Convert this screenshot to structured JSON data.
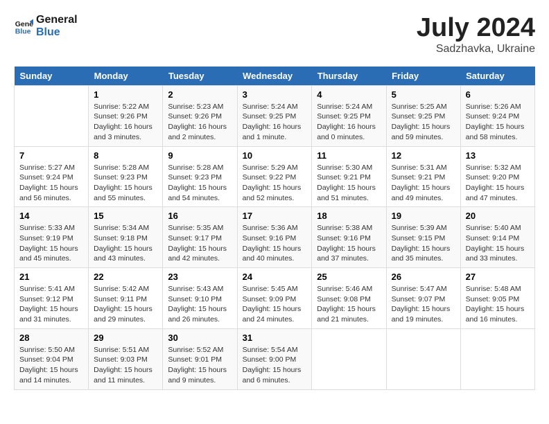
{
  "header": {
    "logo_line1": "General",
    "logo_line2": "Blue",
    "month": "July 2024",
    "location": "Sadzhavka, Ukraine"
  },
  "days_of_week": [
    "Sunday",
    "Monday",
    "Tuesday",
    "Wednesday",
    "Thursday",
    "Friday",
    "Saturday"
  ],
  "weeks": [
    [
      {
        "day": "",
        "info": ""
      },
      {
        "day": "1",
        "info": "Sunrise: 5:22 AM\nSunset: 9:26 PM\nDaylight: 16 hours\nand 3 minutes."
      },
      {
        "day": "2",
        "info": "Sunrise: 5:23 AM\nSunset: 9:26 PM\nDaylight: 16 hours\nand 2 minutes."
      },
      {
        "day": "3",
        "info": "Sunrise: 5:24 AM\nSunset: 9:25 PM\nDaylight: 16 hours\nand 1 minute."
      },
      {
        "day": "4",
        "info": "Sunrise: 5:24 AM\nSunset: 9:25 PM\nDaylight: 16 hours\nand 0 minutes."
      },
      {
        "day": "5",
        "info": "Sunrise: 5:25 AM\nSunset: 9:25 PM\nDaylight: 15 hours\nand 59 minutes."
      },
      {
        "day": "6",
        "info": "Sunrise: 5:26 AM\nSunset: 9:24 PM\nDaylight: 15 hours\nand 58 minutes."
      }
    ],
    [
      {
        "day": "7",
        "info": "Sunrise: 5:27 AM\nSunset: 9:24 PM\nDaylight: 15 hours\nand 56 minutes."
      },
      {
        "day": "8",
        "info": "Sunrise: 5:28 AM\nSunset: 9:23 PM\nDaylight: 15 hours\nand 55 minutes."
      },
      {
        "day": "9",
        "info": "Sunrise: 5:28 AM\nSunset: 9:23 PM\nDaylight: 15 hours\nand 54 minutes."
      },
      {
        "day": "10",
        "info": "Sunrise: 5:29 AM\nSunset: 9:22 PM\nDaylight: 15 hours\nand 52 minutes."
      },
      {
        "day": "11",
        "info": "Sunrise: 5:30 AM\nSunset: 9:21 PM\nDaylight: 15 hours\nand 51 minutes."
      },
      {
        "day": "12",
        "info": "Sunrise: 5:31 AM\nSunset: 9:21 PM\nDaylight: 15 hours\nand 49 minutes."
      },
      {
        "day": "13",
        "info": "Sunrise: 5:32 AM\nSunset: 9:20 PM\nDaylight: 15 hours\nand 47 minutes."
      }
    ],
    [
      {
        "day": "14",
        "info": "Sunrise: 5:33 AM\nSunset: 9:19 PM\nDaylight: 15 hours\nand 45 minutes."
      },
      {
        "day": "15",
        "info": "Sunrise: 5:34 AM\nSunset: 9:18 PM\nDaylight: 15 hours\nand 43 minutes."
      },
      {
        "day": "16",
        "info": "Sunrise: 5:35 AM\nSunset: 9:17 PM\nDaylight: 15 hours\nand 42 minutes."
      },
      {
        "day": "17",
        "info": "Sunrise: 5:36 AM\nSunset: 9:16 PM\nDaylight: 15 hours\nand 40 minutes."
      },
      {
        "day": "18",
        "info": "Sunrise: 5:38 AM\nSunset: 9:16 PM\nDaylight: 15 hours\nand 37 minutes."
      },
      {
        "day": "19",
        "info": "Sunrise: 5:39 AM\nSunset: 9:15 PM\nDaylight: 15 hours\nand 35 minutes."
      },
      {
        "day": "20",
        "info": "Sunrise: 5:40 AM\nSunset: 9:14 PM\nDaylight: 15 hours\nand 33 minutes."
      }
    ],
    [
      {
        "day": "21",
        "info": "Sunrise: 5:41 AM\nSunset: 9:12 PM\nDaylight: 15 hours\nand 31 minutes."
      },
      {
        "day": "22",
        "info": "Sunrise: 5:42 AM\nSunset: 9:11 PM\nDaylight: 15 hours\nand 29 minutes."
      },
      {
        "day": "23",
        "info": "Sunrise: 5:43 AM\nSunset: 9:10 PM\nDaylight: 15 hours\nand 26 minutes."
      },
      {
        "day": "24",
        "info": "Sunrise: 5:45 AM\nSunset: 9:09 PM\nDaylight: 15 hours\nand 24 minutes."
      },
      {
        "day": "25",
        "info": "Sunrise: 5:46 AM\nSunset: 9:08 PM\nDaylight: 15 hours\nand 21 minutes."
      },
      {
        "day": "26",
        "info": "Sunrise: 5:47 AM\nSunset: 9:07 PM\nDaylight: 15 hours\nand 19 minutes."
      },
      {
        "day": "27",
        "info": "Sunrise: 5:48 AM\nSunset: 9:05 PM\nDaylight: 15 hours\nand 16 minutes."
      }
    ],
    [
      {
        "day": "28",
        "info": "Sunrise: 5:50 AM\nSunset: 9:04 PM\nDaylight: 15 hours\nand 14 minutes."
      },
      {
        "day": "29",
        "info": "Sunrise: 5:51 AM\nSunset: 9:03 PM\nDaylight: 15 hours\nand 11 minutes."
      },
      {
        "day": "30",
        "info": "Sunrise: 5:52 AM\nSunset: 9:01 PM\nDaylight: 15 hours\nand 9 minutes."
      },
      {
        "day": "31",
        "info": "Sunrise: 5:54 AM\nSunset: 9:00 PM\nDaylight: 15 hours\nand 6 minutes."
      },
      {
        "day": "",
        "info": ""
      },
      {
        "day": "",
        "info": ""
      },
      {
        "day": "",
        "info": ""
      }
    ]
  ]
}
